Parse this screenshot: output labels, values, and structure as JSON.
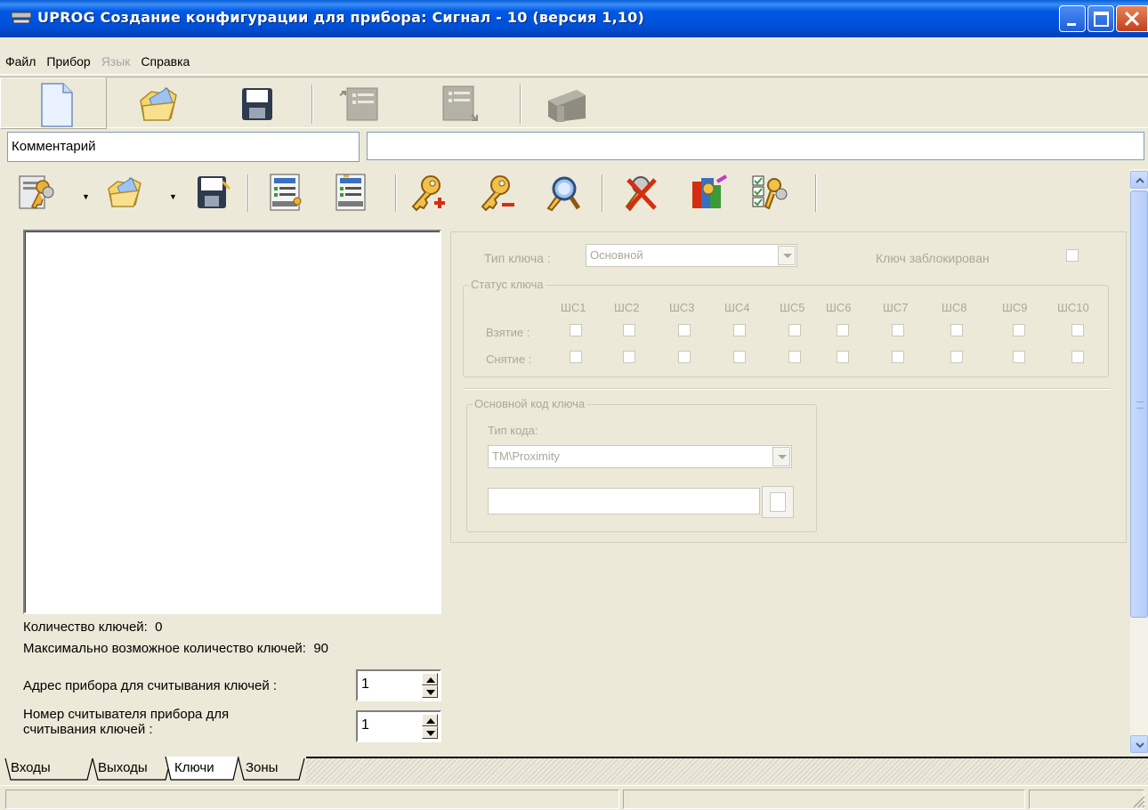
{
  "window": {
    "title": "UPROG  Создание конфигурации для прибора: Сигнал - 10 (версия  1,10)"
  },
  "menu": [
    {
      "label": "Файл",
      "enabled": true
    },
    {
      "label": "Прибор",
      "enabled": true
    },
    {
      "label": "Язык",
      "enabled": false
    },
    {
      "label": "Справка",
      "enabled": true
    }
  ],
  "toolbar_main": [
    "new-document-icon",
    "open-folder-icon",
    "save-disk-icon",
    "read-config-icon",
    "write-config-icon",
    "device-icon"
  ],
  "comment": {
    "label": "Комментарий",
    "value": ""
  },
  "toolbar_keys": [
    "keys-file-icon",
    "open-folder-icon",
    "save-disk-icon",
    "read-keys-icon",
    "write-keys-icon",
    "add-key-icon",
    "remove-key-icon",
    "find-key-icon",
    "delete-keys-icon",
    "key-properties-icon",
    "key-checklist-icon"
  ],
  "keys_panel": {
    "count_label": "Количество ключей:",
    "count_value": "0",
    "max_label": "Максимально возможное количество ключей:",
    "max_value": "90",
    "address_label": "Адрес прибора для считывания ключей :",
    "address_value": "1",
    "reader_label_line1": "Номер считывателя прибора для",
    "reader_label_line2": "считывания ключей :",
    "reader_value": "1"
  },
  "key_details": {
    "key_type_label": "Тип ключа :",
    "key_type_value": "Основной",
    "blocked_label": "Ключ заблокирован",
    "status_group": "Статус ключа",
    "zones": [
      "ШС1",
      "ШС2",
      "ШС3",
      "ШС4",
      "ШС5",
      "ШС6",
      "ШС7",
      "ШС8",
      "ШС9",
      "ШС10"
    ],
    "arm_label": "Взятие :",
    "disarm_label": "Снятие :",
    "code_group": "Основной код ключа",
    "code_type_label": "Тип кода:",
    "code_type_value": "TM\\Proximity",
    "code_value": ""
  },
  "tabs": [
    "Входы",
    "Выходы",
    "Ключи",
    "Зоны"
  ],
  "active_tab": "Ключи"
}
